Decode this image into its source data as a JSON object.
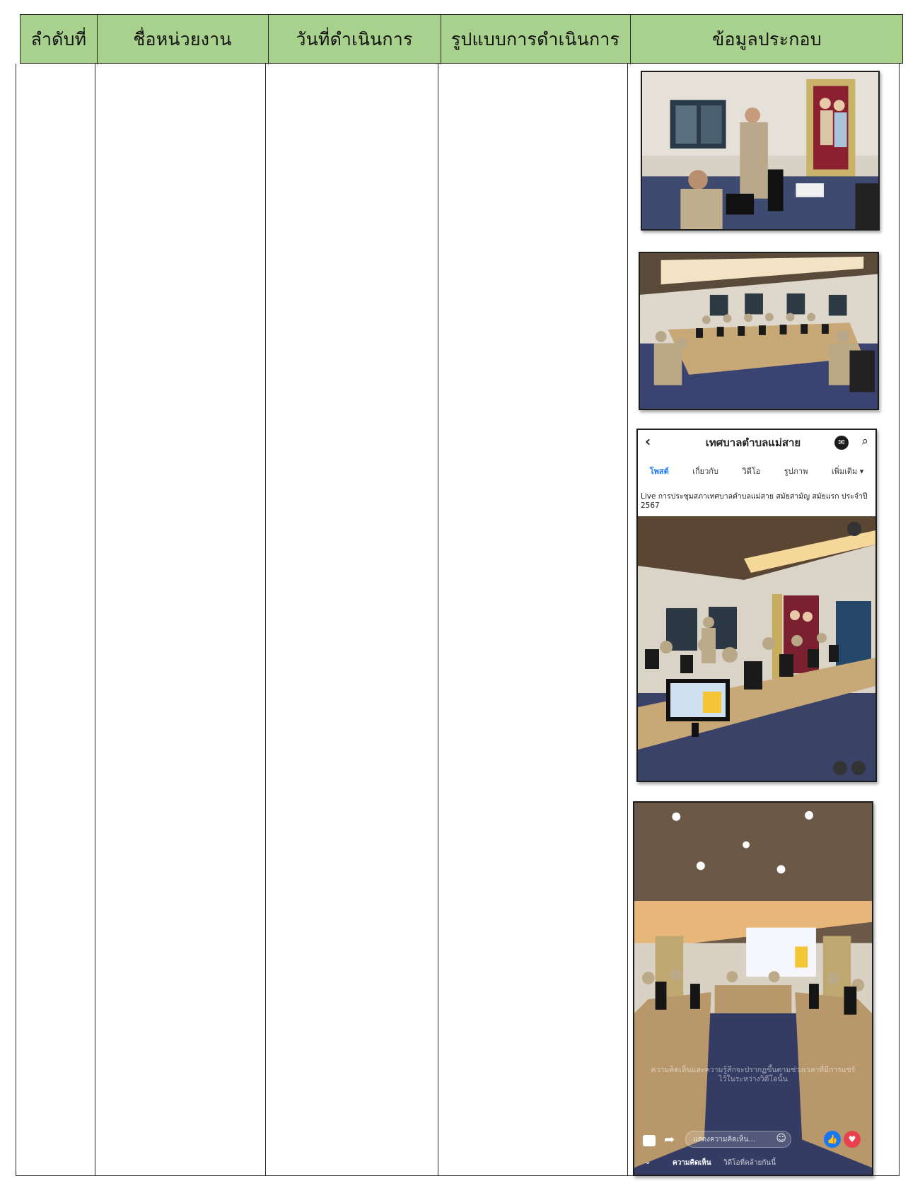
{
  "table": {
    "headers": [
      "ลำดับที่",
      "ชื่อหน่วยงาน",
      "วันที่ดำเนินการ",
      "รูปแบบการดำเนินการ",
      "ข้อมูลประกอบ"
    ]
  },
  "facebook": {
    "page_name": "เทศบาลตำบลแม่สาย",
    "tabs": [
      "โพสต์",
      "เกี่ยวกับ",
      "วิดีโอ",
      "รูปภาพ",
      "เพิ่มเติม ▾"
    ],
    "post_text": "Live การประชุมสภาเทศบาลตำบลแม่สาย สมัยสามัญ สมัยแรก ประจำปี 2567"
  },
  "video_overlay": {
    "caption": "ความคิดเห็นและความรู้สึกจะปรากฏขึ้นตามช่วงเวลาที่มีการแชร์ไว้ในระหว่างวิดีโอนั้น",
    "comment_placeholder": "แสดงความคิดเห็น...",
    "bottom_tabs": [
      "ความคิดเห็น",
      "วิดีโอที่คล้ายกันนี้"
    ]
  },
  "colors": {
    "header_bg": "#a9d18e",
    "border": "#2b2b2b",
    "fb_blue": "#1877f2",
    "like_red": "#e9414f"
  }
}
